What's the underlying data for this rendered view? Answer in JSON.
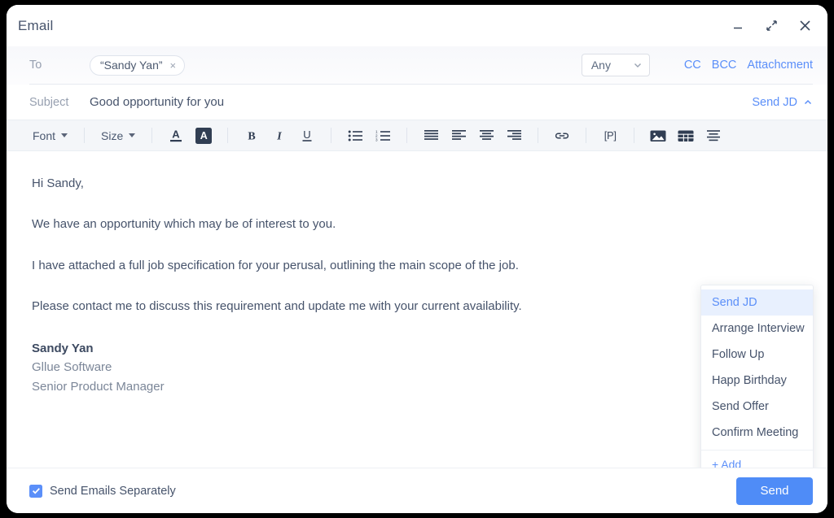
{
  "window": {
    "title": "Email",
    "controls": [
      {
        "name": "minimize",
        "glyph": "minimize-icon"
      },
      {
        "name": "restore",
        "glyph": "restore-icon"
      },
      {
        "name": "close",
        "glyph": "close-icon"
      }
    ]
  },
  "compose": {
    "to": {
      "label": "To",
      "chip_text": "“Sandy Yan”",
      "chip_remove": "×"
    },
    "scope_select": {
      "value": "Any",
      "options": [
        "Any"
      ]
    },
    "links": {
      "cc": "CC",
      "bcc": "BCC",
      "attachment": "Attachcment"
    },
    "subject": {
      "label": "Subject",
      "value": "Good opportunity for you",
      "placeholder": "Subject"
    },
    "template_toggle": {
      "label": "Send JD",
      "expanded": true,
      "chevron": "chevron-up-icon"
    }
  },
  "toolbar": {
    "font": {
      "label": "Font"
    },
    "size": {
      "label": "Size"
    },
    "text_color": {
      "label": "A"
    },
    "highlight_color": {
      "label": "A"
    },
    "bold": {
      "label": "B"
    },
    "italic": {
      "label": "I"
    },
    "underline": {
      "label": "U"
    },
    "bullet_list": {
      "label": ""
    },
    "numbered_list": {
      "label": ""
    },
    "align_justify": {
      "label": ""
    },
    "align_left": {
      "label": ""
    },
    "align_center": {
      "label": ""
    },
    "align_right": {
      "label": ""
    },
    "link": {
      "label": ""
    },
    "placeholder_token": {
      "label": "[P]"
    },
    "insert_image": {
      "label": ""
    },
    "insert_table": {
      "label": ""
    },
    "line_spacing": {
      "label": ""
    }
  },
  "body": {
    "paragraphs": [
      "Hi Sandy,",
      "We have an opportunity which may be of interest to you.",
      "I have attached a full job specification for your perusal, outlining the main scope of the job.",
      "Please contact me to discuss this requirement and update me with your current availability."
    ],
    "signature": {
      "name": "Sandy Yan",
      "company": "Gllue Software",
      "role": "Senior Product Manager"
    }
  },
  "template_menu": {
    "items": [
      {
        "label": "Send JD",
        "selected": true
      },
      {
        "label": "Arrange Interview",
        "selected": false
      },
      {
        "label": "Follow Up",
        "selected": false
      },
      {
        "label": "Happ Birthday",
        "selected": false
      },
      {
        "label": "Send Offer",
        "selected": false
      },
      {
        "label": "Confirm Meeting",
        "selected": false
      }
    ],
    "add_label": "+ Add"
  },
  "footer": {
    "separate_emails": {
      "label": "Send Emails Separately",
      "checked": true
    },
    "send_label": "Send"
  },
  "colors": {
    "accent_blue": "#5b8ff9",
    "send_button": "#4f8cf7",
    "menu_highlight": "#e8f0fe",
    "text_primary": "#46536b",
    "text_muted": "#97a0b0",
    "toolbar_bg": "#f4f6f9",
    "icon_dark": "#313e53"
  }
}
